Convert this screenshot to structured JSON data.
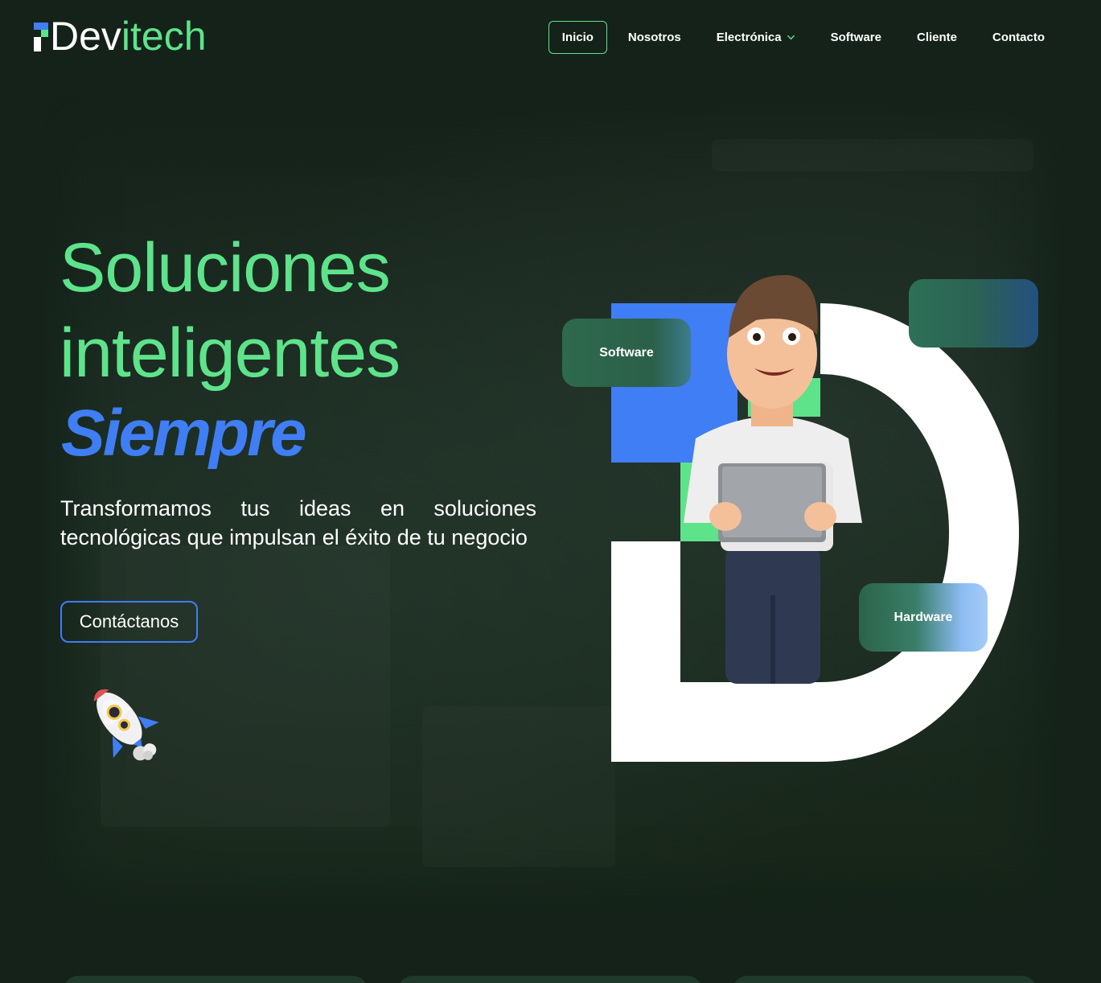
{
  "brand": {
    "name_part1": "Dev",
    "name_part2": "itech",
    "logo_icon": "devitech-logo-icon"
  },
  "nav": {
    "items": [
      {
        "label": "Inicio",
        "active": true
      },
      {
        "label": "Nosotros",
        "active": false
      },
      {
        "label": "Electrónica",
        "active": false,
        "has_dropdown": true
      },
      {
        "label": "Software",
        "active": false
      },
      {
        "label": "Cliente",
        "active": false
      },
      {
        "label": "Contacto",
        "active": false
      }
    ]
  },
  "hero": {
    "title_line1": "Soluciones",
    "title_line2": "inteligentes",
    "accent": "Siempre",
    "subtitle": "Transformamos tus ideas en soluciones tecnológicas que impulsan el éxito de tu negocio",
    "cta_label": "Contáctanos"
  },
  "illustration": {
    "tag_software": "Software",
    "tag_hardware": "Hardware",
    "character": "3d-man-with-tablet",
    "decoration_icon": "rocket-icon"
  },
  "colors": {
    "background": "#142219",
    "accent_green": "#5ee38b",
    "accent_blue": "#3f7ef4",
    "text": "#ffffff"
  }
}
